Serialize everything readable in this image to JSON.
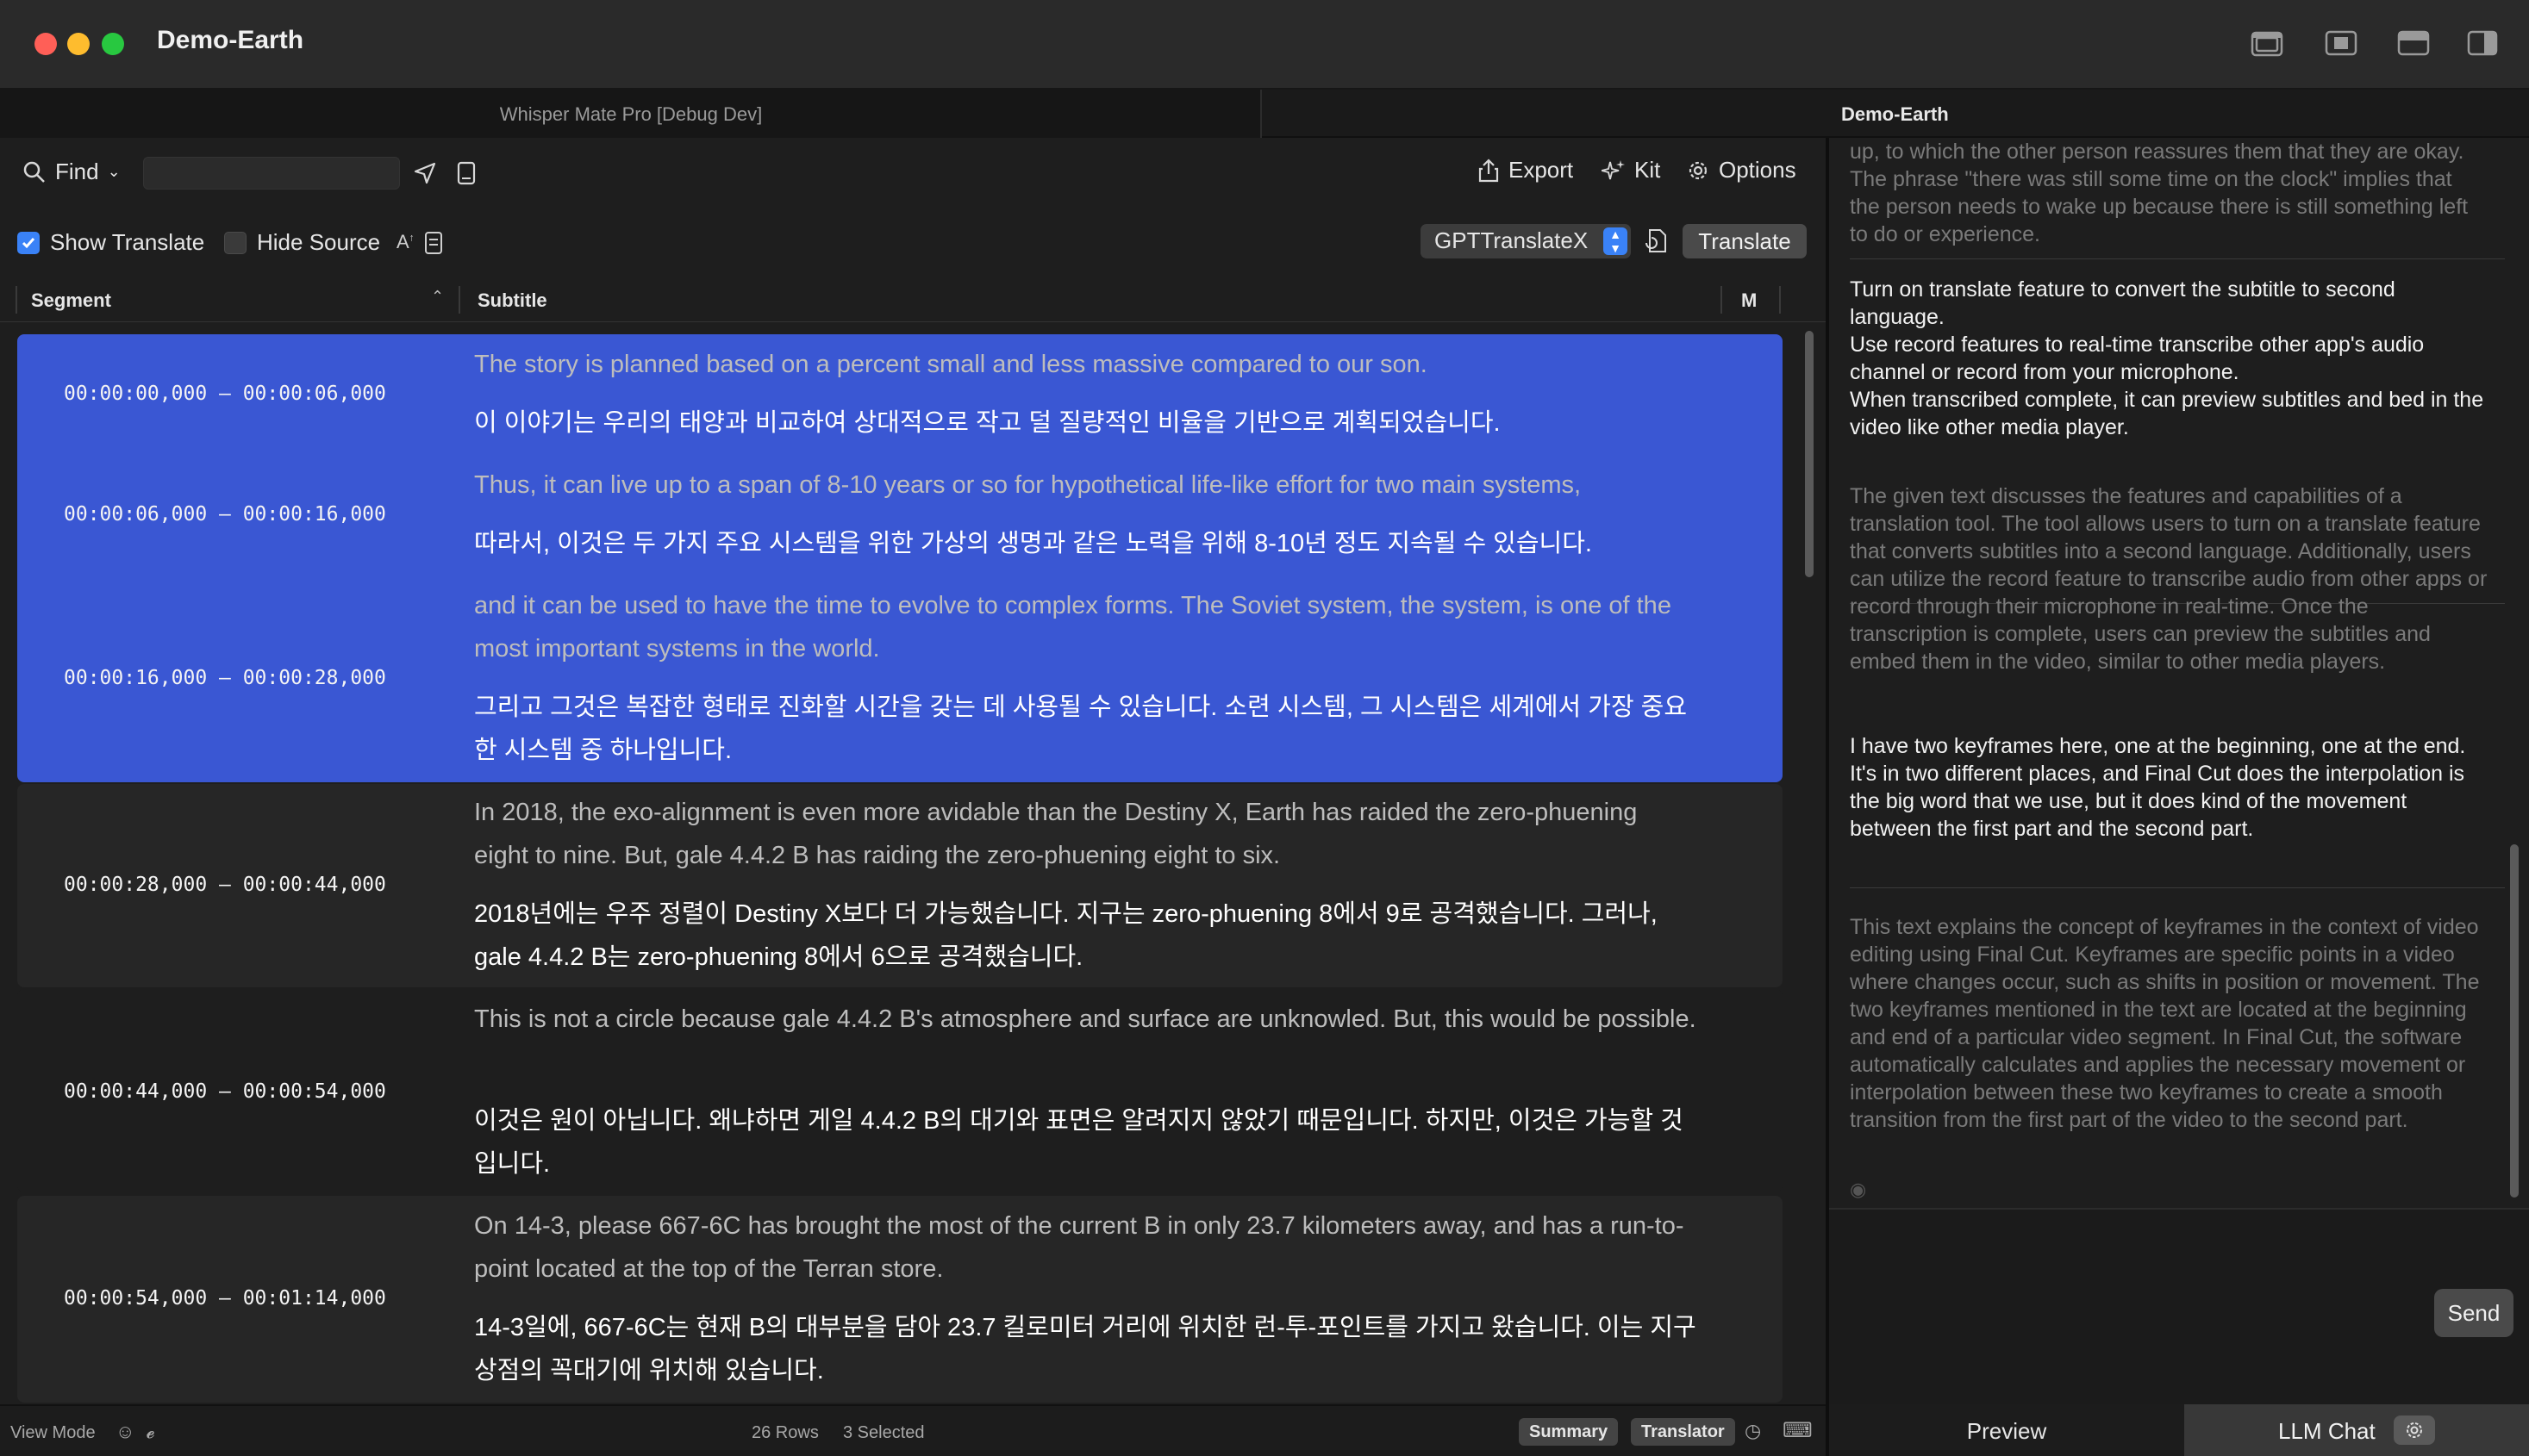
{
  "window": {
    "title": "Demo-Earth"
  },
  "tabs": {
    "left": "Whisper Mate Pro [Debug Dev]",
    "right": "Demo-Earth"
  },
  "toolbar": {
    "find_label": "Find",
    "find_value": "",
    "export_label": "Export",
    "kit_label": "Kit",
    "options_label": "Options",
    "show_translate_label": "Show Translate",
    "show_translate_checked": true,
    "hide_source_label": "Hide Source",
    "hide_source_checked": false,
    "engine_selected": "GPTTranslateX",
    "translate_label": "Translate"
  },
  "table": {
    "columns": [
      "Segment",
      "Subtitle",
      "M"
    ],
    "rows": [
      {
        "time": "00:00:00,000 – 00:00:06,000",
        "source": "The story is planned based on a percent small and less massive compared to our son.",
        "translation": "이 이야기는 우리의 태양과 비교하여 상대적으로 작고 덜 질량적인 비율을 기반으로 계획되었습니다.",
        "selected": true
      },
      {
        "time": "00:00:06,000 – 00:00:16,000",
        "source": "Thus, it can live up to a span of 8-10 years or so for hypothetical life-like effort for two main systems,",
        "translation": "따라서, 이것은 두 가지 주요 시스템을 위한 가상의 생명과 같은 노력을 위해 8-10년 정도 지속될 수 있습니다.",
        "selected": true
      },
      {
        "time": "00:00:16,000 – 00:00:28,000",
        "source": "and it can be used to have the time to evolve to complex forms. The Soviet system, the system, is one of the most important systems in the world.",
        "translation": "그리고 그것은 복잡한 형태로 진화할 시간을 갖는 데 사용될 수 있습니다. 소련 시스템, 그 시스템은 세계에서 가장 중요한 시스템 중 하나입니다.",
        "selected": true
      },
      {
        "time": "00:00:28,000 – 00:00:44,000",
        "source": "In 2018, the exo-alignment is even more avidable than the Destiny X, Earth has raided the zero-phuening eight to nine. But, gale 4.4.2 B has raiding the zero-phuening eight to six.",
        "translation": "2018년에는 우주 정렬이 Destiny X보다 더 가능했습니다. 지구는 zero-phuening 8에서 9로 공격했습니다. 그러나, gale 4.4.2 B는 zero-phuening 8에서 6으로 공격했습니다.",
        "selected": false
      },
      {
        "time": "00:00:44,000 – 00:00:54,000",
        "source": "This is not a circle because gale 4.4.2 B's atmosphere and surface are unknowled. But, this would be possible.",
        "translation": "이것은 원이 아닙니다. 왜냐하면 게일 4.4.2 B의 대기와 표면은 알려지지 않았기 때문입니다. 하지만, 이것은 가능할 것입니다.",
        "selected": false
      },
      {
        "time": "00:00:54,000 – 00:01:14,000",
        "source": "On 14-3, please 667-6C has brought the most of the current B in only 23.7 kilometers away, and has a run-to-point located at the top of the Terran store.",
        "translation": "14-3일에, 667-6C는 현재 B의 대부분을 담아 23.7 킬로미터 거리에 위치한 런-투-포인트를 가지고 왔습니다. 이는 지구 상점의 꼭대기에 위치해 있습니다.",
        "selected": false
      }
    ]
  },
  "status": {
    "view_mode": "View Mode",
    "rows": "26 Rows",
    "selected": "3 Selected",
    "summary": "Summary",
    "translator": "Translator"
  },
  "chat": {
    "messages": [
      {
        "role": "ai",
        "text": "up, to which the other person reassures them that they are okay. The phrase \"there was still some time on the clock\" implies that the person needs to wake up because there is still something left to do or experience."
      },
      {
        "role": "user",
        "text": "Turn on translate feature to convert the subtitle to second language.\nUse record features to real-time transcribe other app's audio channel or record from your microphone.\nWhen transcribed complete, it can preview subtitles and bed in the video like other media player."
      },
      {
        "role": "ai",
        "text": "The given text discusses the features and capabilities of a translation tool. The tool allows users to turn on a translate feature that converts subtitles into a second language. Additionally, users can utilize the record feature to transcribe audio from other apps or record through their microphone in real-time. Once the transcription is complete, users can preview the subtitles and embed them in the video, similar to other media players."
      },
      {
        "role": "user",
        "text": "I have two keyframes here, one at the beginning, one at the end.\nIt's in two different places, and Final Cut does the interpolation is the big word that we use, but it does kind of the movement between the first part and the second part."
      },
      {
        "role": "ai",
        "text": "This text explains the concept of keyframes in the context of video editing using Final Cut. Keyframes are specific points in a video where changes occur, such as shifts in position or movement. The two keyframes mentioned in the text are located at the beginning and end of a particular video segment. In Final Cut, the software automatically calculates and applies the necessary movement or interpolation between these two keyframes to create a smooth transition from the first part of the video to the second part."
      }
    ],
    "input_value": "",
    "send_label": "Send"
  },
  "bottom_tabs": {
    "preview": "Preview",
    "llm_chat": "LLM Chat",
    "active": "LLM Chat"
  }
}
